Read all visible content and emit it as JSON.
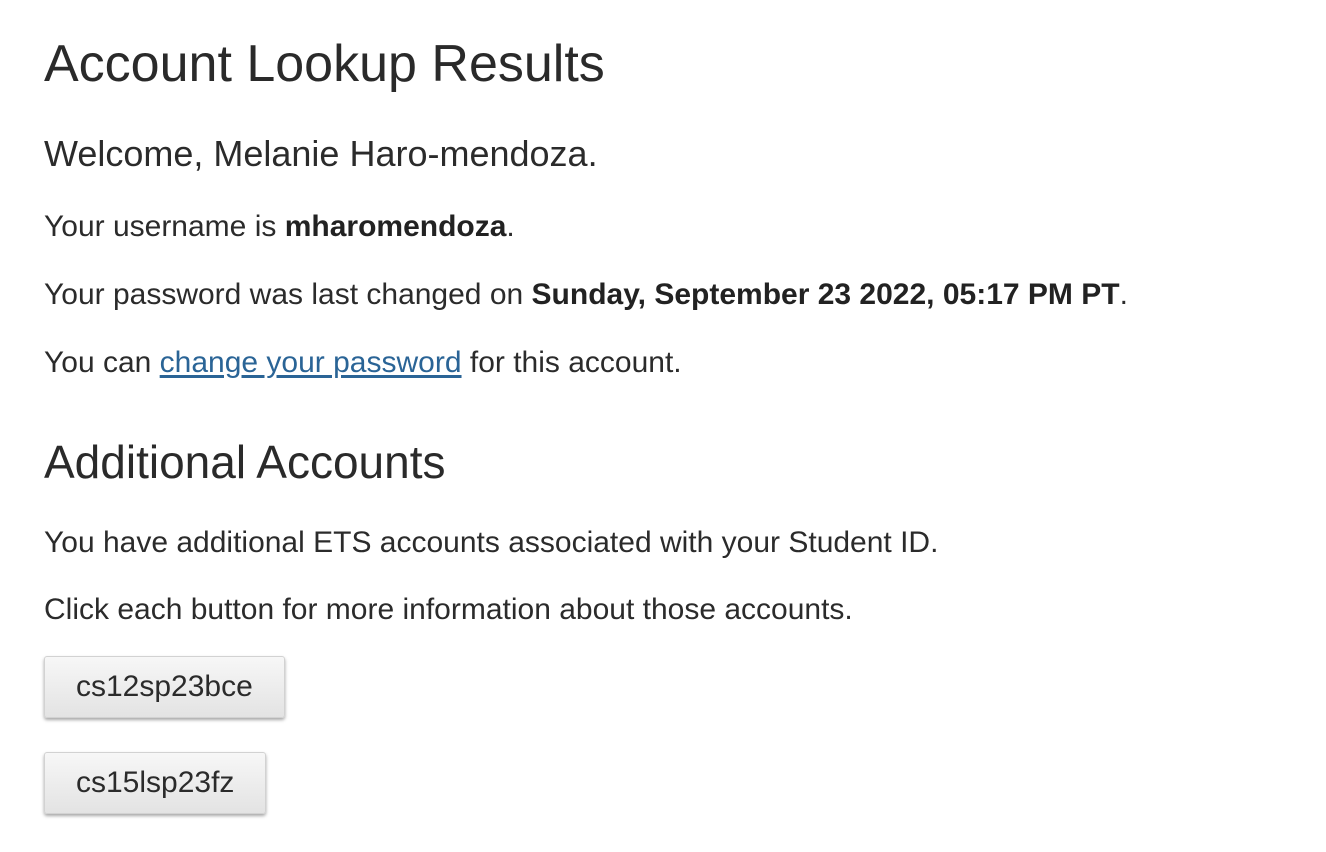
{
  "page": {
    "title": "Account Lookup Results",
    "welcome": "Welcome, Melanie Haro-mendoza.",
    "username_prefix": "Your username is ",
    "username": "mharomendoza",
    "username_suffix": ".",
    "password_prefix": "Your password was last changed on ",
    "password_changed": "Sunday, September 23 2022, 05:17 PM PT",
    "password_suffix": ".",
    "change_prefix": "You can ",
    "change_link": "change your password",
    "change_suffix": " for this account."
  },
  "additional": {
    "heading": "Additional Accounts",
    "description": "You have additional ETS accounts associated with your Student ID.",
    "instructions": "Click each button for more information about those accounts.",
    "accounts": [
      "cs12sp23bce",
      "cs15lsp23fz"
    ]
  },
  "colors": {
    "link": "#2a6496",
    "text": "#2b2b2b"
  }
}
